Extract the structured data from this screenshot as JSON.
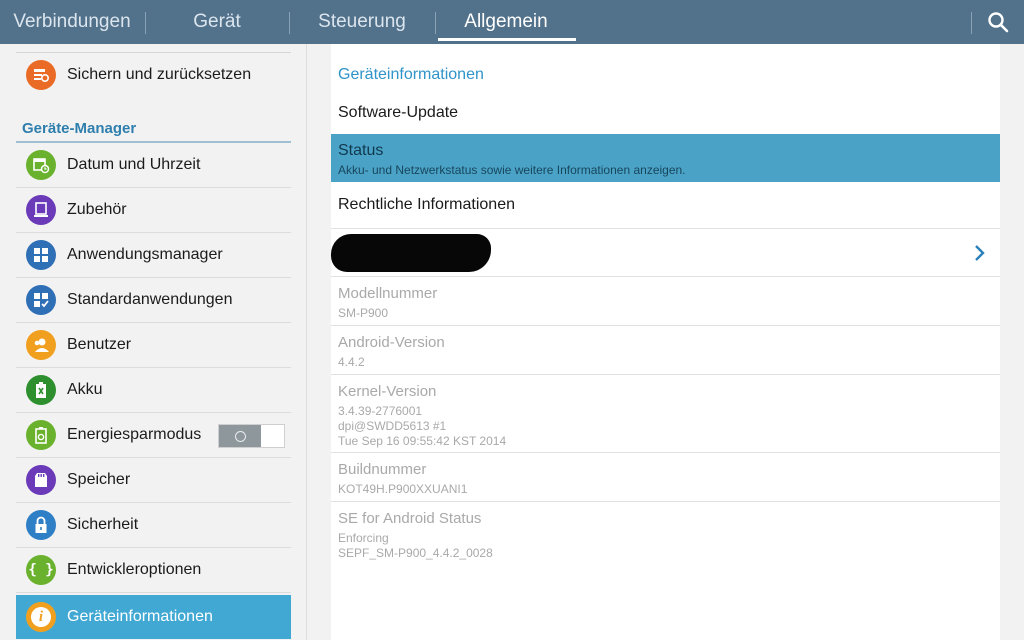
{
  "tabs": [
    {
      "label": "Verbindungen",
      "active": false
    },
    {
      "label": "Gerät",
      "active": false
    },
    {
      "label": "Steuerung",
      "active": false
    },
    {
      "label": "Allgemein",
      "active": true
    }
  ],
  "sidebar": {
    "top_item": "Sichern und zurücksetzen",
    "section_title": "Geräte-Manager",
    "items": [
      {
        "label": "Datum und Uhrzeit",
        "icon": "clock-calendar-icon",
        "color": "#6ab22e"
      },
      {
        "label": "Zubehör",
        "icon": "accessory-icon",
        "color": "#6a3ab8"
      },
      {
        "label": "Anwendungsmanager",
        "icon": "apps-grid-icon",
        "color": "#2f6fb6"
      },
      {
        "label": "Standardanwendungen",
        "icon": "default-apps-icon",
        "color": "#2f6fb6"
      },
      {
        "label": "Benutzer",
        "icon": "user-icon",
        "color": "#f0a01e"
      },
      {
        "label": "Akku",
        "icon": "battery-icon",
        "color": "#3a9a3a"
      },
      {
        "label": "Energiesparmodus",
        "icon": "power-saving-icon",
        "color": "#6ab22e"
      },
      {
        "label": "Speicher",
        "icon": "storage-icon",
        "color": "#6a3ab8"
      },
      {
        "label": "Sicherheit",
        "icon": "lock-icon",
        "color": "#2f7fc6"
      },
      {
        "label": "Entwickleroptionen",
        "icon": "developer-braces-icon",
        "color": "#6ab22e"
      },
      {
        "label": "Geräteinformationen",
        "icon": "info-icon",
        "color": "#f0a01e",
        "selected": true
      }
    ],
    "power_saving_toggle": "off"
  },
  "main": {
    "section_title": "Geräteinformationen",
    "software_update": "Software-Update",
    "status_title": "Status",
    "status_sub": "Akku- und Netzwerkstatus sowie weitere Informationen anzeigen.",
    "legal": "Rechtliche Informationen",
    "model_title": "Modellnummer",
    "model_value": "SM-P900",
    "android_title": "Android-Version",
    "android_value": "4.4.2",
    "kernel_title": "Kernel-Version",
    "kernel_line1": "3.4.39-2776001",
    "kernel_line2": "dpi@SWDD5613 #1",
    "kernel_line3": "Tue Sep 16 09:55:42 KST 2014",
    "build_title": "Buildnummer",
    "build_value": "KOT49H.P900XXUANI1",
    "se_title": "SE for Android Status",
    "se_line1": "Enforcing",
    "se_line2": "SEPF_SM-P900_4.4.2_0028"
  }
}
